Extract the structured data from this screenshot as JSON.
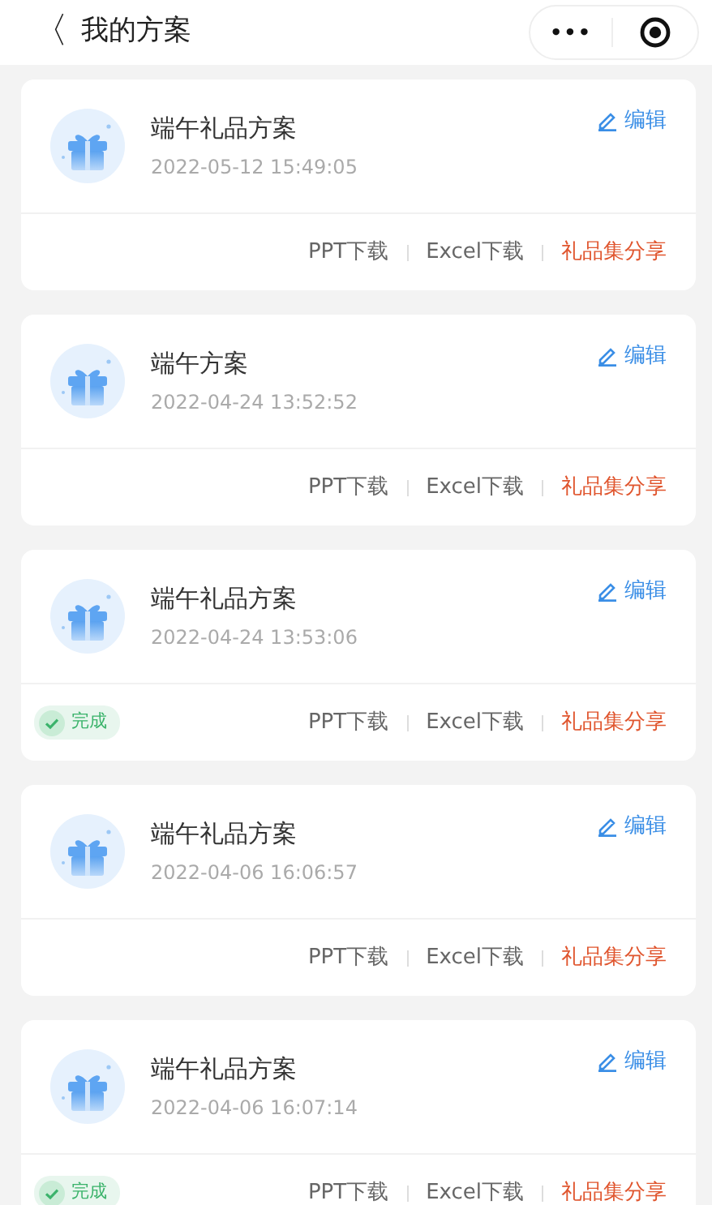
{
  "header": {
    "back": "〈",
    "title": "我的方案",
    "more": "•••"
  },
  "plans": [
    {
      "title": "端午礼品方案",
      "time": "2022-05-12 15:49:05",
      "edit": "编辑",
      "actions": [
        {
          "label": "PPT下载",
          "kind": "download"
        },
        {
          "label": "Excel下载",
          "kind": "download"
        },
        {
          "label": "礼品集分享",
          "kind": "share"
        }
      ]
    },
    {
      "title": "端午方案",
      "time": "2022-04-24 13:52:52",
      "edit": "编辑",
      "actions": [
        {
          "label": "PPT下载",
          "kind": "download"
        },
        {
          "label": "Excel下载",
          "kind": "download"
        },
        {
          "label": "礼品集分享",
          "kind": "share"
        }
      ]
    },
    {
      "title": "端午礼品方案",
      "time": "2022-04-24 13:53:06",
      "edit": "编辑",
      "badge": "完成",
      "actions": [
        {
          "label": "PPT下载",
          "kind": "download"
        },
        {
          "label": "Excel下载",
          "kind": "download"
        },
        {
          "label": "礼品集分享",
          "kind": "share"
        }
      ]
    },
    {
      "title": "端午礼品方案",
      "time": "2022-04-06 16:06:57",
      "edit": "编辑",
      "actions": [
        {
          "label": "PPT下载",
          "kind": "download"
        },
        {
          "label": "Excel下载",
          "kind": "download"
        },
        {
          "label": "礼品集分享",
          "kind": "share"
        }
      ]
    },
    {
      "title": "端午礼品方案",
      "time": "2022-04-06 16:07:14",
      "edit": "编辑",
      "badge": "完成",
      "actions": [
        {
          "label": "PPT下载",
          "kind": "download"
        },
        {
          "label": "Excel下载",
          "kind": "download"
        },
        {
          "label": "礼品集分享",
          "kind": "share"
        }
      ]
    }
  ]
}
